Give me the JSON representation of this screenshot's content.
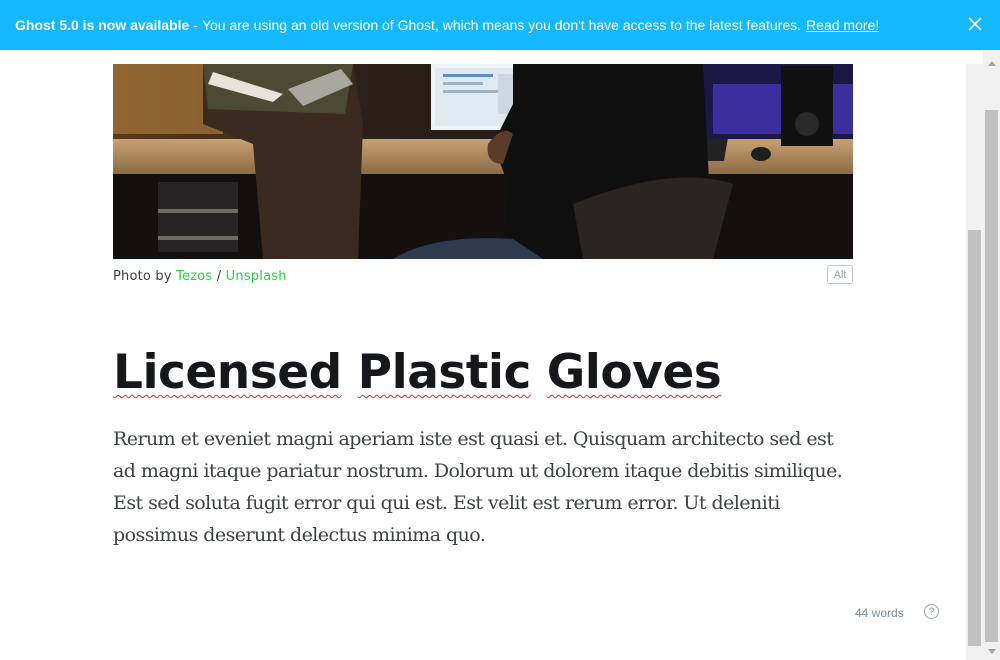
{
  "banner": {
    "headline": "Ghost 5.0 is now available",
    "separator": "-",
    "message": "You are using an old version of Ghost, which means you don't have access to the latest features.",
    "link_label": "Read more!",
    "background_color": "#14b8ff",
    "close_icon": "close-icon"
  },
  "image": {
    "caption_prefix": "Photo by",
    "author": "Tezos",
    "caption_separator": "/",
    "source": "Unsplash",
    "alt_label": "Alt",
    "link_color": "#30cf43"
  },
  "post": {
    "title_words": [
      "Licensed",
      "Plastic",
      "Gloves"
    ],
    "body": "Rerum et eveniet magni aperiam iste est quasi et. Quisquam architecto sed est ad magni itaque pariatur nostrum. Dolorum ut dolorem itaque debitis similique. Est sed soluta fugit error qui qui est. Est velit est rerum error. Ut deleniti possimus deserunt delectus minima quo."
  },
  "footer": {
    "word_count": "44 words",
    "help_label": "?",
    "help_icon": "help-circle-icon"
  },
  "scrollbar": {
    "up_icon": "scroll-up-arrow-icon",
    "down_icon": "scroll-down-arrow-icon"
  }
}
